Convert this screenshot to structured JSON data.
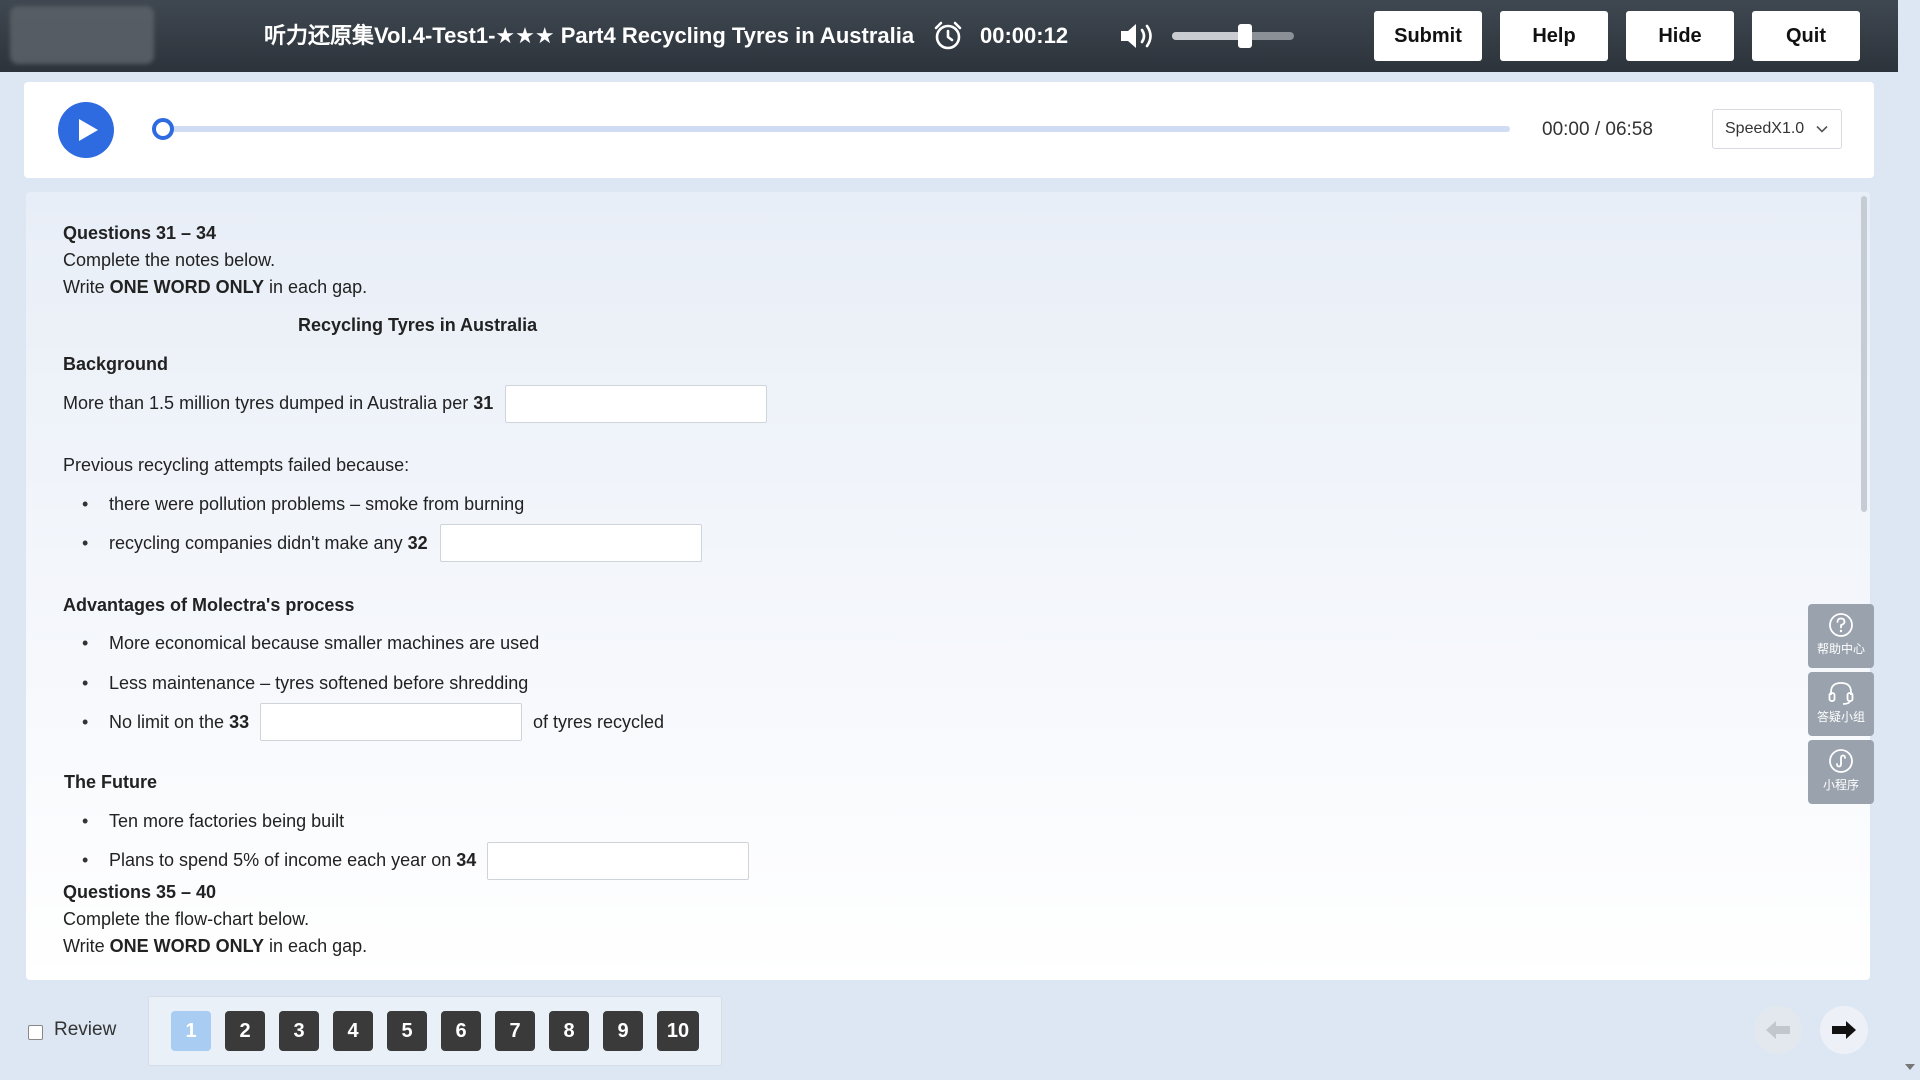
{
  "header": {
    "title": "听力还原集Vol.4-Test1-★★★ Part4 Recycling Tyres in Australia",
    "timer": "00:00:12",
    "volume_level": 0.6,
    "buttons": {
      "submit": "Submit",
      "help": "Help",
      "hide": "Hide",
      "quit": "Quit"
    }
  },
  "player": {
    "time": "00:00 / 06:58",
    "progress": 0,
    "speed": "SpeedX1.0"
  },
  "questions": {
    "section1": {
      "heading": "Questions 31 – 34",
      "instruction": "Complete the notes below.",
      "write_prefix": "Write ",
      "write_bold": "ONE WORD ONLY",
      "write_suffix": " in each gap.",
      "notes_title": "Recycling Tyres in Australia",
      "background_heading": "Background",
      "q31_text": "More than 1.5 million tyres dumped in Australia per ",
      "q31_num": "31",
      "previous_text": "Previous recycling attempts failed because:",
      "bullet_pollution": "there were pollution problems – smoke from burning",
      "q32_text": "recycling companies didn't make any ",
      "q32_num": "32",
      "advantages_heading": "Advantages of Molectra's process",
      "bullet_economical": "More economical because smaller machines are used",
      "bullet_maintenance": "Less maintenance – tyres softened before shredding",
      "q33_text": "No limit on the ",
      "q33_num": "33",
      "q33_suffix": "of tyres recycled",
      "future_heading": "The Future",
      "bullet_factories": "Ten more factories being built",
      "q34_text": "Plans to spend 5% of income each year on ",
      "q34_num": "34"
    },
    "section2": {
      "heading": "Questions 35 – 40",
      "instruction": "Complete the flow-chart below.",
      "write_prefix": "Write ",
      "write_bold": "ONE WORD ONLY",
      "write_suffix": " in each gap."
    }
  },
  "sidetools": [
    {
      "label": "帮助中心",
      "icon": "question-circle-icon"
    },
    {
      "label": "答疑小组",
      "icon": "headset-icon"
    },
    {
      "label": "小程序",
      "icon": "mini-program-icon"
    }
  ],
  "footer": {
    "review_label": "Review",
    "pages": [
      "1",
      "2",
      "3",
      "4",
      "5",
      "6",
      "7",
      "8",
      "9",
      "10"
    ],
    "active_page": "1"
  },
  "colors": {
    "accent": "#2f6be0",
    "topbar": "#333a42",
    "active_page": "#a9cdf2"
  }
}
